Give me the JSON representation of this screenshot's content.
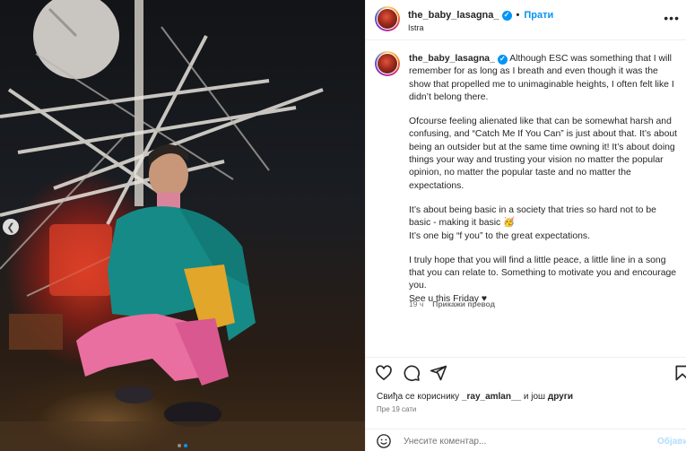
{
  "post": {
    "username": "the_baby_lasagna_",
    "verified": true,
    "follow_label": "Прати",
    "location": "Istra",
    "more_icon": "more-horizontal-icon"
  },
  "caption": {
    "username": "the_baby_lasagna_",
    "paragraphs": [
      "Although ESC was something that I will remember for as long as I breath and even though it was the show that propelled me to unimaginable heights, I often felt like I didn’t belong there.",
      "Ofcourse feeling alienated like that can be somewhat harsh and confusing, and “Catch Me If You Can” is just about that. It’s about being an outsider but at the same time owning it! It’s about doing things your way and trusting your vision no matter the popular opinion, no matter the popular taste and no matter the expectations.",
      "It’s about being basic in a society that tries so hard not to be basic - making it basic 🥳\nIt’s one big “f you” to the great expectations.",
      "I truly hope that you will find a little peace, a little line in a song that you can relate to. Something to motivate you and encourage you.\nSee u this Friday ♥"
    ],
    "age": "19 ч",
    "translate_label": "Прикажи превод"
  },
  "actions": {
    "like_icon": "heart-icon",
    "comment_icon": "comment-icon",
    "share_icon": "share-icon",
    "save_icon": "bookmark-icon"
  },
  "likes": {
    "prefix": "Свиђа се кориснику ",
    "user": "_ray_amlan__",
    "middle": " и још ",
    "suffix": "други"
  },
  "timestamp": "Пре 19 сати",
  "comment": {
    "placeholder": "Унесите коментар...",
    "post_label": "Објави"
  },
  "carousel": {
    "slide_count": 2,
    "current_slide": 2
  }
}
